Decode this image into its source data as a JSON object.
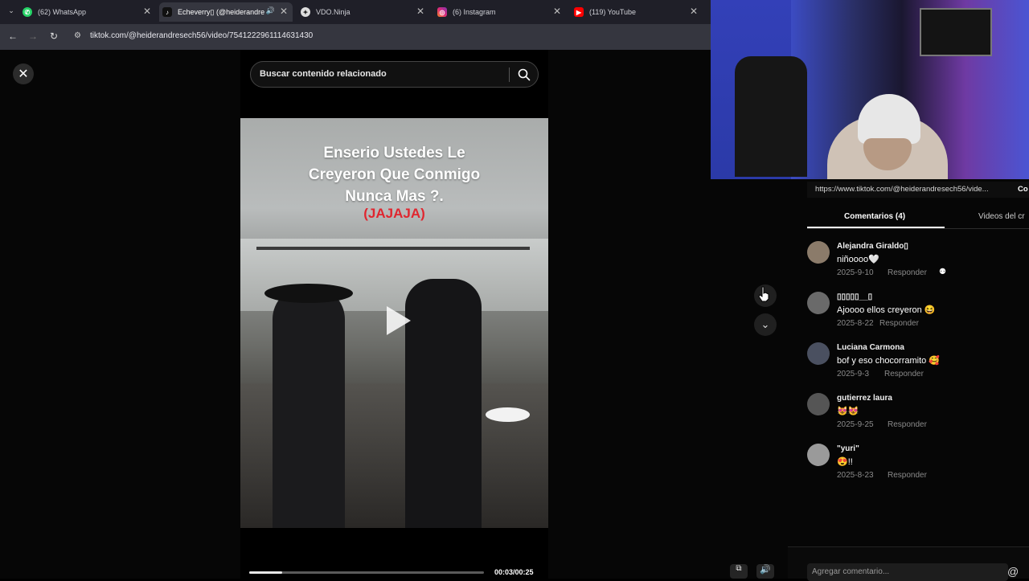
{
  "browser": {
    "tabs": [
      {
        "label": "(62) WhatsApp",
        "icon": "whatsapp-icon",
        "color": "#25d366"
      },
      {
        "label": "Echeverry▯ (@heiderandre",
        "icon": "tiktok-icon",
        "color": "#111111",
        "active": true
      },
      {
        "label": "VDO.Ninja",
        "icon": "vdo-ninja-icon",
        "color": "#dddddd"
      },
      {
        "label": "(6) Instagram",
        "icon": "instagram-icon",
        "color": "#e1306c"
      },
      {
        "label": "(119) YouTube",
        "icon": "youtube-icon",
        "color": "#ff0000"
      }
    ],
    "url": "tiktok.com/@heiderandresech56/video/7541222961114631430"
  },
  "player": {
    "search_placeholder": "Buscar contenido relacionado",
    "title": "Enserio Ustedes Le\nCreyeron Que Conmigo\nNunca Mas ?.",
    "laugh": "(JAJAJA)",
    "time": "00:03/00:25",
    "progress": 0.14
  },
  "panel": {
    "link": "https://www.tiktok.com/@heiderandresech56/vide...",
    "copy_label": "Co",
    "tab_comments": "Comentarios (4)",
    "tab_videos": "Videos del cr",
    "comments": [
      {
        "author": "Alejandra Giraldo▯",
        "text": "niñoooo🤍",
        "date": "2025-9-10",
        "reply": "Responder",
        "avatar_color": "#8b7b6a"
      },
      {
        "author": "▯▯▯▯▯__▯",
        "text": "Ajoooo ellos creyeron 😆",
        "date": "2025-8-22",
        "reply": "Responder",
        "avatar_color": "#6a6a6a"
      },
      {
        "author": "Luciana Carmona",
        "text": "bof y eso chocorramito 🥰",
        "date": "2025-9-3",
        "reply": "Responder",
        "avatar_color": "#4a5060"
      },
      {
        "author": "gutierrez laura",
        "text": "😻😻",
        "date": "2025-9-25",
        "reply": "Responder",
        "avatar_color": "#555555"
      },
      {
        "author": "\"yuri\"",
        "text": "😍!!",
        "date": "2025-8-23",
        "reply": "Responder",
        "avatar_color": "#9a9a9a"
      }
    ],
    "comment_placeholder": "Agregar comentario..."
  }
}
